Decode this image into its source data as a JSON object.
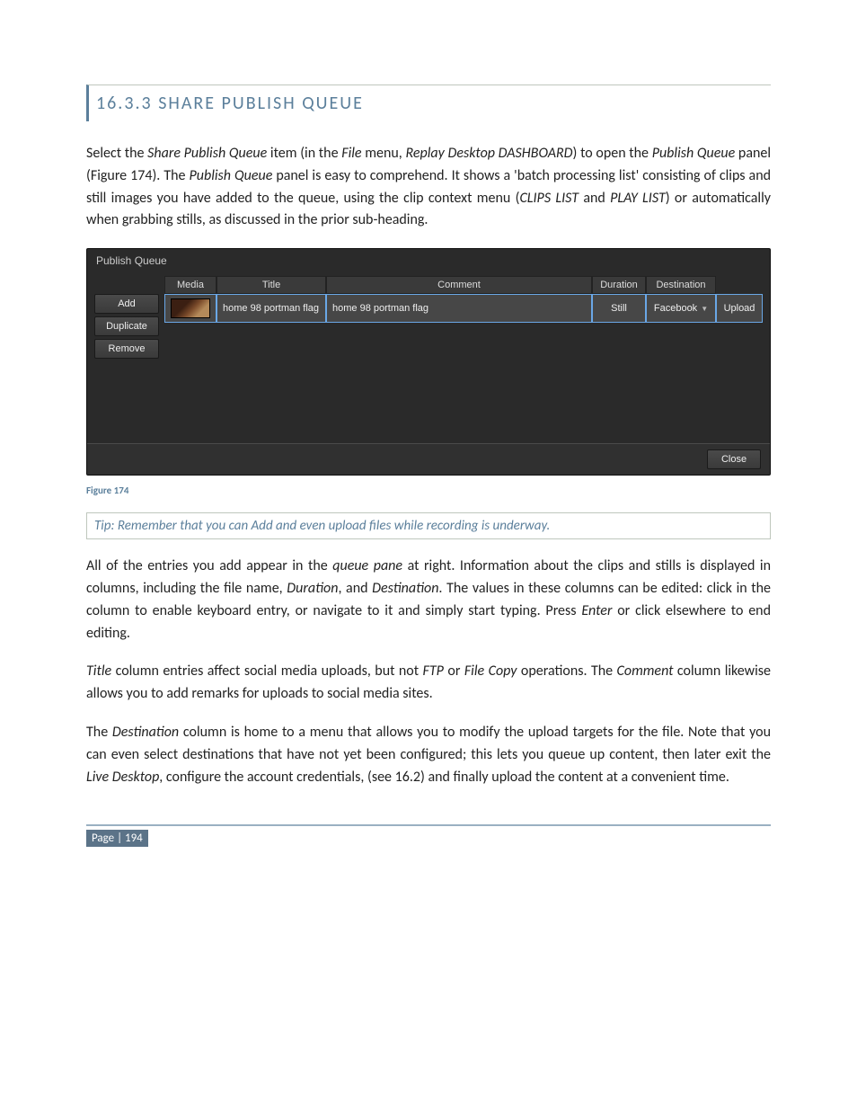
{
  "section": {
    "number": "16.3.3",
    "title": "SHARE PUBLISH QUEUE"
  },
  "para1": {
    "t0": "Select the ",
    "i0": "Share Publish Queue",
    "t1": " item (in the ",
    "i1": "File",
    "t2": " menu, ",
    "i2": "Replay Desktop DASHBOARD",
    "t3": ") to open the ",
    "i3": "Publish Queue",
    "t4": " panel (Figure 174).  The ",
    "i4": "Publish Queue",
    "t5": " panel is easy to comprehend.  It shows a 'batch processing list' consisting of clips and still images you have added to the queue, using the clip context menu (",
    "i5": "CLIPS LIST",
    "t6": " and ",
    "i6": "PLAY LIST",
    "t7": ") or automatically when grabbing stills, as discussed in the prior sub-heading."
  },
  "panel": {
    "title": "Publish Queue",
    "buttons": {
      "add": "Add",
      "duplicate": "Duplicate",
      "remove": "Remove",
      "close": "Close",
      "upload": "Upload"
    },
    "headers": {
      "media": "Media",
      "title": "Title",
      "comment": "Comment",
      "duration": "Duration",
      "destination": "Destination"
    },
    "row": {
      "title": "home 98 portman flag",
      "comment": "home 98 portman flag",
      "duration": "Still",
      "destination": "Facebook"
    }
  },
  "figcap": "Figure 174",
  "tip": "Tip:  Remember that you can Add and even upload files while recording is underway.",
  "para2": {
    "t0": "All of the entries you add appear in the ",
    "i0": "queue pane",
    "t1": " at right.  Information about the clips and stills is displayed in columns, including the file name, ",
    "i1": "Duration",
    "t2": ", and ",
    "i2": "Destination",
    "t3": ".  The values in these columns can be edited: click in the column to enable keyboard entry, or navigate to it and simply start typing.  Press ",
    "i3": "Enter",
    "t4": " or click elsewhere to end editing."
  },
  "para3": {
    "i0": "Title",
    "t0": " column entries affect social media uploads, but not ",
    "i1": "FTP",
    "t1": " or ",
    "i2": "File Copy",
    "t2": " operations. The ",
    "i3": "Comment",
    "t3": " column likewise allows you to add remarks for uploads to social media sites."
  },
  "para4": {
    "t0": "The ",
    "i0": "Destination",
    "t1": " column is home to a menu that allows you to modify the upload targets for the file.  Note that you can even select destinations that have not yet been configured; this lets you queue up content, then later exit the ",
    "i1": "Live Desktop",
    "t2": ", configure the account credentials, (see 16.2) and finally upload the content at a convenient time."
  },
  "pagenum": "Page | 194"
}
